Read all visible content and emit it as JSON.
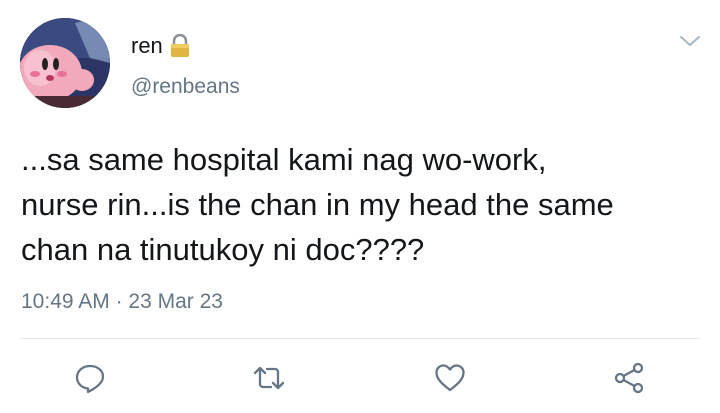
{
  "user": {
    "display_name": "ren",
    "handle": "@renbeans",
    "protected_icon": "lock-icon",
    "avatar_icon": "kirby-avatar"
  },
  "tweet": {
    "text": "...sa same hospital kami nag wo-work,\nnurse rin...is the chan in my head the same\nchan na tinutukoy ni doc????",
    "time": "10:49 AM",
    "separator": " · ",
    "date": "23 Mar 23"
  },
  "actions": [
    {
      "name": "reply",
      "icon": "reply-icon"
    },
    {
      "name": "retweet",
      "icon": "retweet-icon"
    },
    {
      "name": "like",
      "icon": "heart-icon"
    },
    {
      "name": "share",
      "icon": "share-icon"
    }
  ],
  "colors": {
    "text_primary": "#14171a",
    "text_secondary": "#657786",
    "divider": "#e1e8ed",
    "lock_gold": "#e0b640"
  }
}
